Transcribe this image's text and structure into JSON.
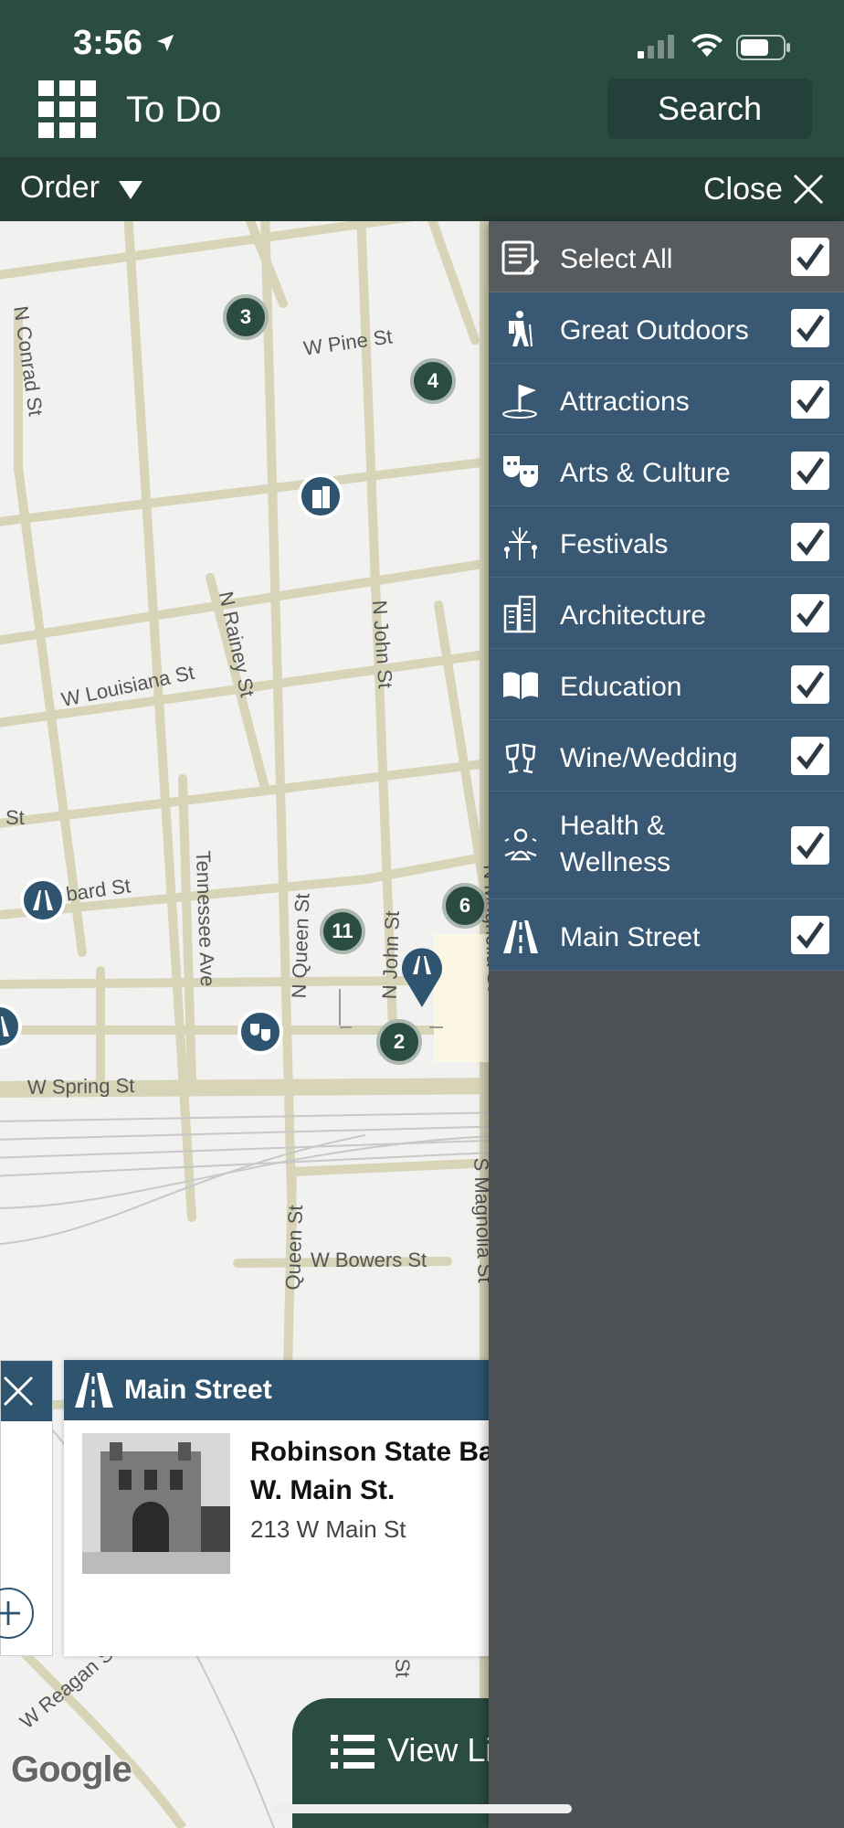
{
  "status_bar": {
    "time": "3:56"
  },
  "header": {
    "title": "To Do",
    "search_label": "Search"
  },
  "subbar": {
    "order_label": "Order",
    "close_label": "Close"
  },
  "map": {
    "streets": [
      "W Pine St",
      "N Conrad St",
      "N Rainey St",
      "N John St",
      "W Louisiana St",
      "St",
      "ebard St",
      "Tennessee Ave",
      "N Queen St",
      "N John St",
      "N Magnolia St",
      "W Spring St",
      "Queen St",
      "W Bowers St",
      "S Magnolia St",
      "W Reagan St",
      "St"
    ],
    "clusters": [
      "3",
      "4",
      "6",
      "11",
      "2"
    ],
    "attribution": "Google"
  },
  "filters": [
    {
      "label": "Select All",
      "icon": "checklist-icon",
      "checked": true
    },
    {
      "label": "Great Outdoors",
      "icon": "hiker-icon",
      "checked": true
    },
    {
      "label": "Attractions",
      "icon": "flag-icon",
      "checked": true
    },
    {
      "label": "Arts & Culture",
      "icon": "theater-masks-icon",
      "checked": true
    },
    {
      "label": "Festivals",
      "icon": "fireworks-icon",
      "checked": true
    },
    {
      "label": "Architecture",
      "icon": "buildings-icon",
      "checked": true
    },
    {
      "label": "Education",
      "icon": "book-icon",
      "checked": true
    },
    {
      "label": "Wine/Wedding",
      "icon": "wine-glasses-icon",
      "checked": true
    },
    {
      "label": "Health & Wellness",
      "icon": "meditation-icon",
      "checked": true
    },
    {
      "label": "Main Street",
      "icon": "road-icon",
      "checked": true
    }
  ],
  "card": {
    "category": "Main Street",
    "name_line1": "Robinson State Ba",
    "name_line2": "W. Main St.",
    "address": "213 W Main St"
  },
  "view_list_label": "View Li",
  "colors": {
    "header": "#2b4c41",
    "panel_row": "#395873",
    "panel_bg": "#4e5255",
    "card_header": "#2e5470"
  }
}
